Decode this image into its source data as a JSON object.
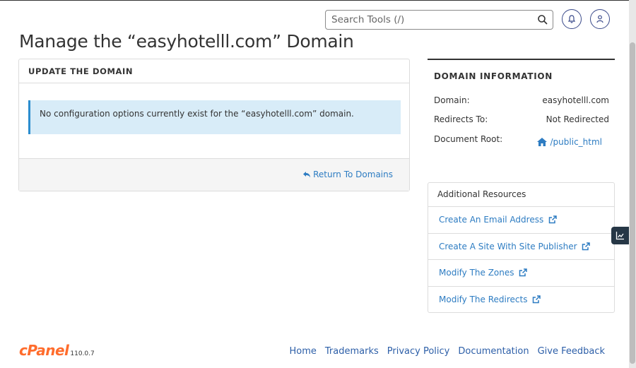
{
  "header": {
    "search_placeholder": "Search Tools (/)"
  },
  "page": {
    "title": "Manage the “easyhotelll.com” Domain"
  },
  "update_panel": {
    "heading": "UPDATE THE DOMAIN",
    "message": "No configuration options currently exist for the “easyhotelll.com” domain.",
    "return_label": "Return To Domains"
  },
  "domain_info": {
    "heading": "DOMAIN INFORMATION",
    "rows": [
      {
        "label": "Domain:",
        "value": "easyhotelll.com"
      },
      {
        "label": "Redirects To:",
        "value": "Not Redirected"
      },
      {
        "label": "Document Root:",
        "value": "/public_html"
      }
    ]
  },
  "resources": {
    "heading": "Additional Resources",
    "items": [
      "Create An Email Address",
      "Create A Site With Site Publisher",
      "Modify The Zones",
      "Modify The Redirects"
    ]
  },
  "footer": {
    "brand": "cPanel",
    "version": "110.0.7",
    "links": [
      "Home",
      "Trademarks",
      "Privacy Policy",
      "Documentation",
      "Give Feedback"
    ]
  },
  "colors": {
    "link": "#2d7cc2",
    "alert_bg": "#d8ecf8",
    "alert_border": "#2b8dcf",
    "brand_orange": "#ff6c2c",
    "stats_tab": "#263746"
  },
  "icons": {
    "search": "search-icon",
    "bell": "bell-icon",
    "user": "user-icon",
    "return": "return-arrow-icon",
    "home": "home-icon",
    "external": "external-link-icon",
    "stats": "chart-icon"
  }
}
